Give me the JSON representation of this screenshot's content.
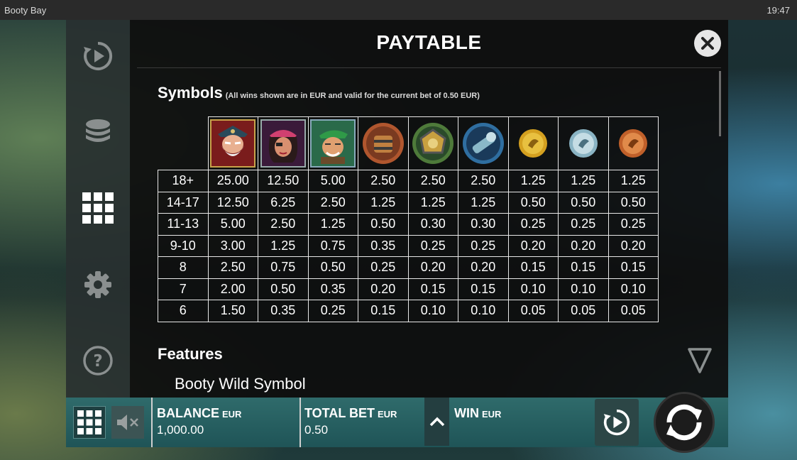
{
  "window": {
    "title": "Booty Bay",
    "time": "19:47"
  },
  "sidebar": {
    "items": [
      {
        "icon": "autoplay-icon"
      },
      {
        "icon": "coins-icon"
      },
      {
        "icon": "paytable-grid-icon",
        "active": true
      },
      {
        "icon": "gear-icon"
      },
      {
        "icon": "help-icon"
      }
    ]
  },
  "paytable": {
    "title": "PAYTABLE",
    "symbols_heading": "Symbols",
    "symbols_note": "(All wins shown are in EUR and valid for the current bet of 0.50 EUR)",
    "symbols": [
      {
        "icon": "bearded-pirate-captain-icon",
        "color": "#c8a24a"
      },
      {
        "icon": "pirate-woman-icon",
        "color": "#7a3a7a"
      },
      {
        "icon": "green-bandana-pirate-icon",
        "color": "#3f8a58"
      },
      {
        "icon": "treasure-barrel-icon",
        "color": "#b0562e"
      },
      {
        "icon": "golden-compass-icon",
        "color": "#4e7a3a"
      },
      {
        "icon": "spyglass-icon",
        "color": "#2f6ea0"
      },
      {
        "icon": "gold-coin-icon",
        "color": "#d4a020"
      },
      {
        "icon": "silver-coin-icon",
        "color": "#9cc4d4"
      },
      {
        "icon": "bronze-coin-icon",
        "color": "#d0703a"
      }
    ],
    "rows": [
      {
        "count": "18+",
        "values": [
          "25.00",
          "12.50",
          "5.00",
          "2.50",
          "2.50",
          "2.50",
          "1.25",
          "1.25",
          "1.25"
        ]
      },
      {
        "count": "14-17",
        "values": [
          "12.50",
          "6.25",
          "2.50",
          "1.25",
          "1.25",
          "1.25",
          "0.50",
          "0.50",
          "0.50"
        ]
      },
      {
        "count": "11-13",
        "values": [
          "5.00",
          "2.50",
          "1.25",
          "0.50",
          "0.30",
          "0.30",
          "0.25",
          "0.25",
          "0.25"
        ]
      },
      {
        "count": "9-10",
        "values": [
          "3.00",
          "1.25",
          "0.75",
          "0.35",
          "0.25",
          "0.25",
          "0.20",
          "0.20",
          "0.20"
        ]
      },
      {
        "count": "8",
        "values": [
          "2.50",
          "0.75",
          "0.50",
          "0.25",
          "0.20",
          "0.20",
          "0.15",
          "0.15",
          "0.15"
        ]
      },
      {
        "count": "7",
        "values": [
          "2.00",
          "0.50",
          "0.35",
          "0.20",
          "0.15",
          "0.15",
          "0.10",
          "0.10",
          "0.10"
        ]
      },
      {
        "count": "6",
        "values": [
          "1.50",
          "0.35",
          "0.25",
          "0.15",
          "0.10",
          "0.10",
          "0.05",
          "0.05",
          "0.05"
        ]
      }
    ],
    "features_heading": "Features",
    "feature_item": "Booty Wild Symbol"
  },
  "bottombar": {
    "balance_label": "BALANCE",
    "balance_unit": "EUR",
    "balance_value": "1,000.00",
    "totalbet_label": "TOTAL BET",
    "totalbet_unit": "EUR",
    "totalbet_value": "0.50",
    "win_label": "WIN",
    "win_unit": "EUR"
  }
}
